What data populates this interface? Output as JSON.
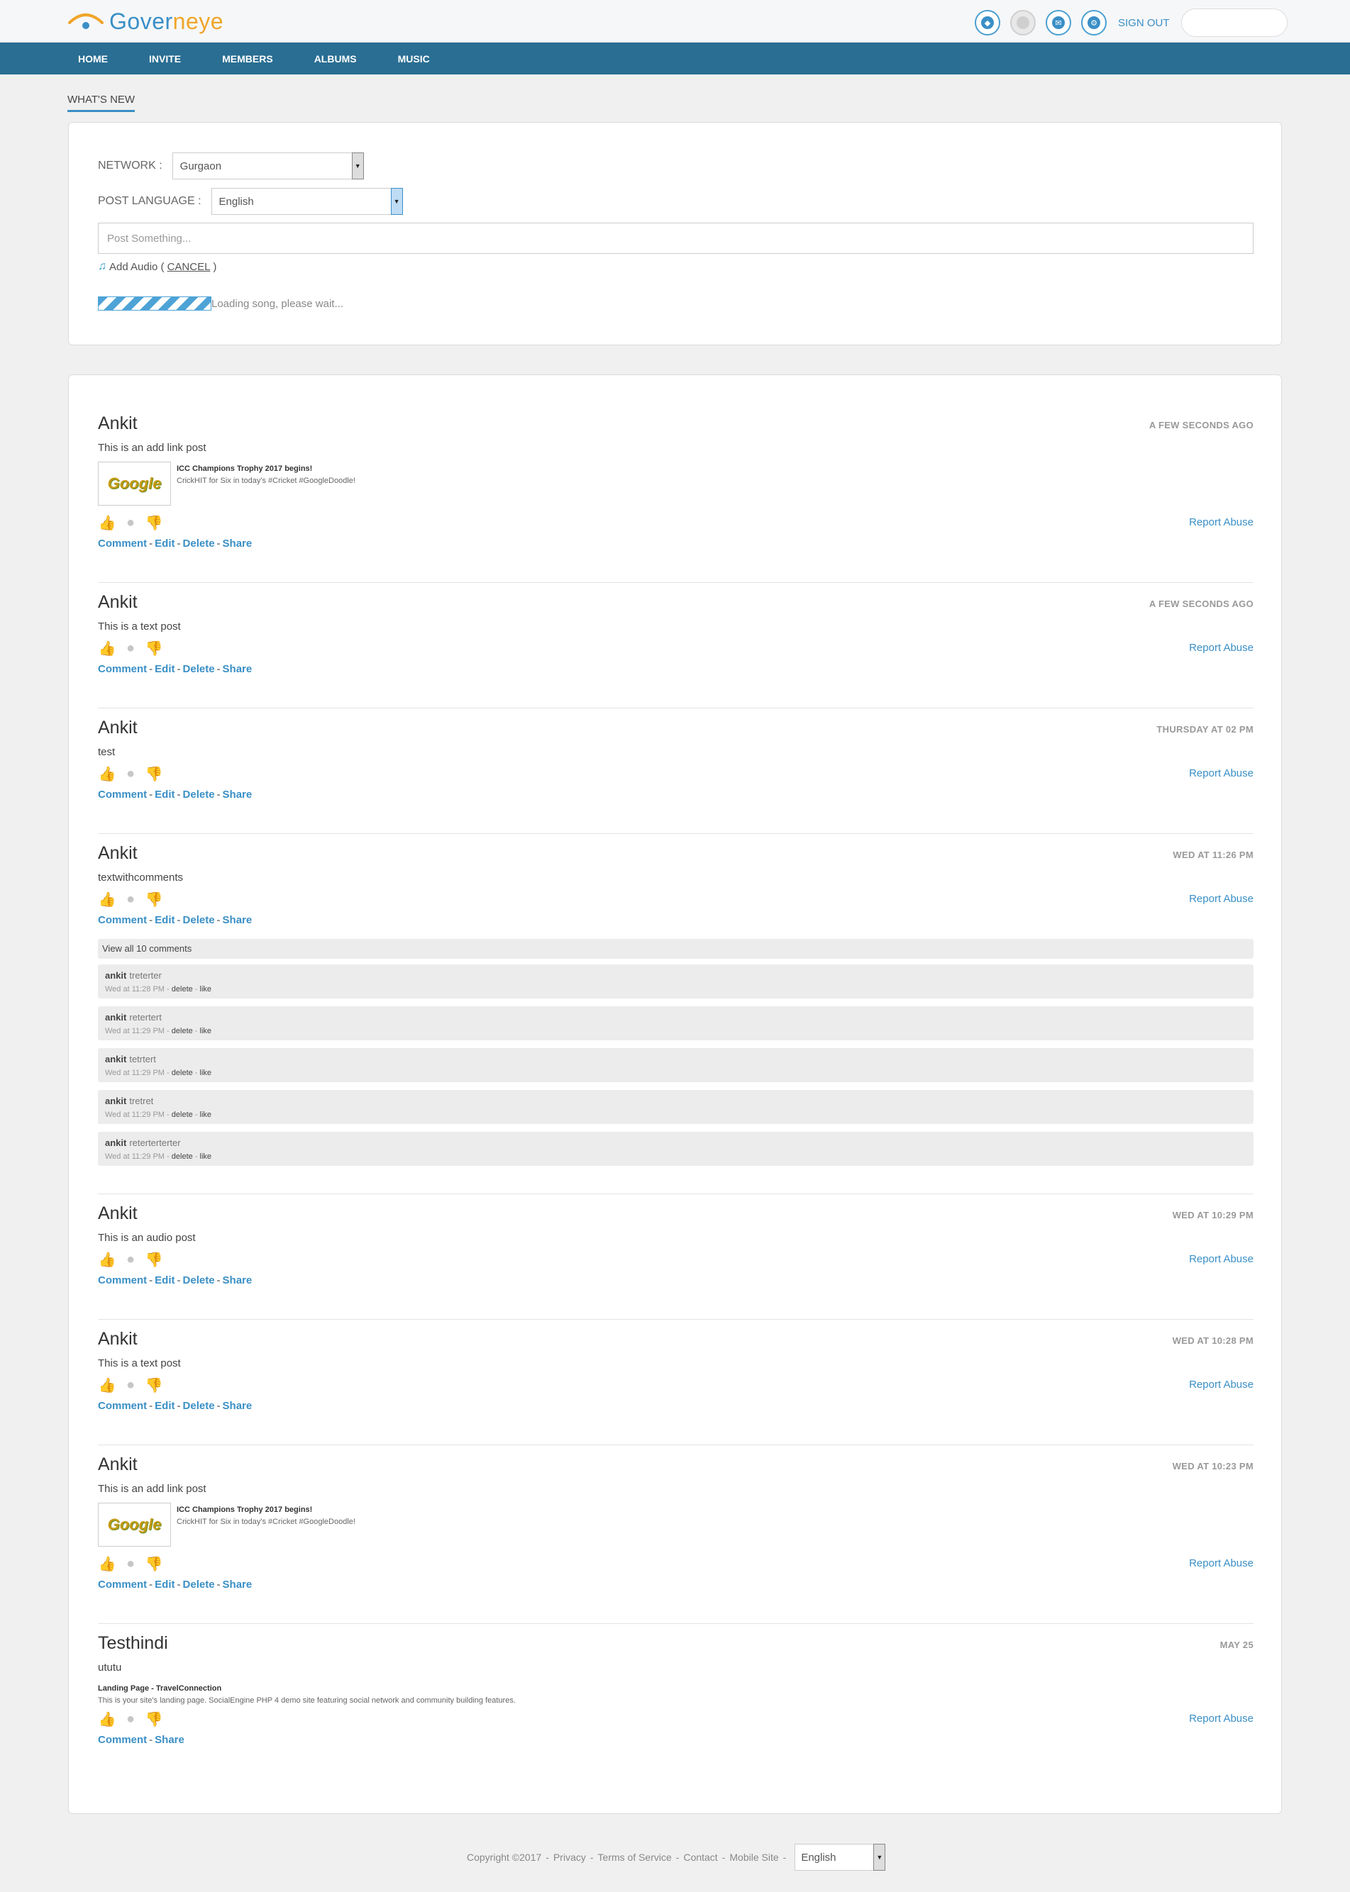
{
  "header": {
    "logo_part1": "Gover",
    "logo_part2": "neye",
    "signout": "SIGN OUT"
  },
  "nav": [
    "HOME",
    "INVITE",
    "MEMBERS",
    "ALBUMS",
    "MUSIC"
  ],
  "section_title": "WHAT'S NEW",
  "composer": {
    "network_label": "NETWORK :",
    "network_value": "Gurgaon",
    "language_label": "POST LANGUAGE :",
    "language_value": "English",
    "post_placeholder": "Post Something...",
    "add_audio": "Add Audio (",
    "cancel": "CANCEL",
    "add_audio_close": ")",
    "loading": "Loading song, please wait..."
  },
  "feed": [
    {
      "name": "Ankit",
      "time": "A FEW SECONDS AGO",
      "body": "This is an add link post",
      "link": {
        "title": "ICC Champions Trophy 2017 begins!",
        "desc": "CrickHIT for Six in today's #Cricket #GoogleDoodle!",
        "thumb_text": "Google"
      },
      "actions": [
        "Comment",
        "Edit",
        "Delete",
        "Share"
      ],
      "report": "Report Abuse"
    },
    {
      "name": "Ankit",
      "time": "A FEW SECONDS AGO",
      "body": "This is a text post",
      "actions": [
        "Comment",
        "Edit",
        "Delete",
        "Share"
      ],
      "report": "Report Abuse"
    },
    {
      "name": "Ankit",
      "time": "THURSDAY AT 02 PM",
      "body": "test",
      "actions": [
        "Comment",
        "Edit",
        "Delete",
        "Share"
      ],
      "report": "Report Abuse"
    },
    {
      "name": "Ankit",
      "time": "WED AT 11:26 PM",
      "body": "textwithcomments",
      "actions": [
        "Comment",
        "Edit",
        "Delete",
        "Share"
      ],
      "report": "Report Abuse",
      "view_all": "View all 10 comments",
      "comments": [
        {
          "who": "ankit",
          "text": "treterter",
          "time": "Wed at 11:28 PM",
          "delete": "delete",
          "like": "like"
        },
        {
          "who": "ankit",
          "text": "retertert",
          "time": "Wed at 11:29 PM",
          "delete": "delete",
          "like": "like"
        },
        {
          "who": "ankit",
          "text": "tetrtert",
          "time": "Wed at 11:29 PM",
          "delete": "delete",
          "like": "like"
        },
        {
          "who": "ankit",
          "text": "tretret",
          "time": "Wed at 11:29 PM",
          "delete": "delete",
          "like": "like"
        },
        {
          "who": "ankit",
          "text": "reterterterter",
          "time": "Wed at 11:29 PM",
          "delete": "delete",
          "like": "like"
        }
      ]
    },
    {
      "name": "Ankit",
      "time": "WED AT 10:29 PM",
      "body": "This is an audio post",
      "actions": [
        "Comment",
        "Edit",
        "Delete",
        "Share"
      ],
      "report": "Report Abuse"
    },
    {
      "name": "Ankit",
      "time": "WED AT 10:28 PM",
      "body": "This is a text post",
      "actions": [
        "Comment",
        "Edit",
        "Delete",
        "Share"
      ],
      "report": "Report Abuse"
    },
    {
      "name": "Ankit",
      "time": "WED AT 10:23 PM",
      "body": "This is an add link post",
      "link": {
        "title": "ICC Champions Trophy 2017 begins!",
        "desc": "CrickHIT for Six in today's #Cricket #GoogleDoodle!",
        "thumb_text": "Google"
      },
      "actions": [
        "Comment",
        "Edit",
        "Delete",
        "Share"
      ],
      "report": "Report Abuse"
    },
    {
      "name": "Testhindi",
      "time": "MAY 25",
      "body": "ututu",
      "link2": {
        "title": "Landing Page - TravelConnection",
        "desc": "This is your site's landing page. SocialEngine PHP 4 demo site featuring social network and community building features."
      },
      "actions": [
        "Comment",
        "Share"
      ],
      "report": "Report Abuse"
    }
  ],
  "footer": {
    "copyright": "Copyright ©2017",
    "privacy": "Privacy",
    "terms": "Terms of Service",
    "contact": "Contact",
    "mobile": "Mobile Site",
    "language": "English",
    "separator": "-"
  },
  "colors": {
    "brand_blue": "#3a8fc6",
    "brand_orange": "#f0a52a",
    "nav_bg": "#2a6e93"
  }
}
